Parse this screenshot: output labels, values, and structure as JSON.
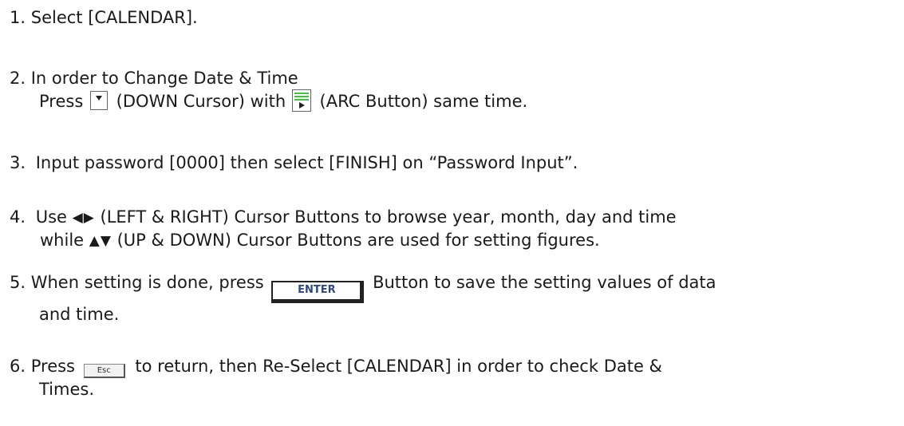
{
  "steps": [
    {
      "num": "1.",
      "text": "Select [CALENDAR]."
    },
    {
      "num": "2.",
      "line1": "In order to Change Date & Time",
      "line2_a": "Press",
      "line2_b": "(DOWN Cursor) with",
      "line2_c": "(ARC Button) same time."
    },
    {
      "num": "3.",
      "text": "Input password [0000] then select [FINISH] on “Password Input”."
    },
    {
      "num": "4.",
      "line1_arrows": "◀▶",
      "line1_a": "Use",
      "line1_b": "(LEFT & RIGHT) Cursor Buttons to browse year, month, day and time",
      "line2_a": "while",
      "line2_arrows": "▲▼",
      "line2_b": "(UP & DOWN) Cursor Buttons are used for setting figures."
    },
    {
      "num": "5.",
      "line1_a": "When setting is done, press",
      "enter_label": "ENTER",
      "line1_b": "Button to save the setting values of data",
      "line2": "and time."
    },
    {
      "num": "6.",
      "line1_a": "Press",
      "esc_label": "Esc",
      "line1_b": "to return, then Re-Select [CALENDAR] in order to check Date &",
      "line2": "Times."
    }
  ]
}
